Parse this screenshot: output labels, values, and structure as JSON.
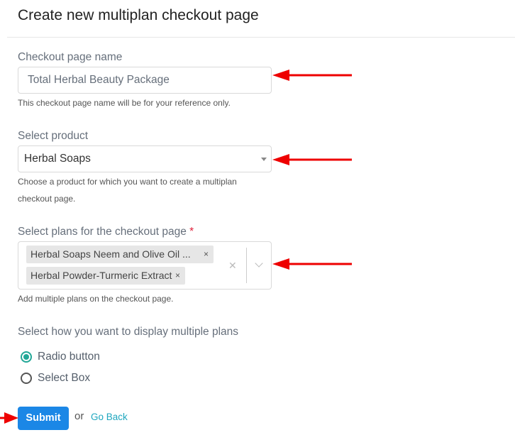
{
  "page": {
    "title": "Create new multiplan checkout page"
  },
  "form": {
    "checkout_name": {
      "label": "Checkout page name",
      "value": "Total Herbal Beauty Package",
      "help": "This checkout page name will be for your reference only."
    },
    "product": {
      "label": "Select product",
      "value": "Herbal Soaps",
      "help": "Choose a product for which you want to create a multiplan checkout page."
    },
    "plans": {
      "label": "Select plans for the checkout page",
      "required_mark": "*",
      "selected": [
        "Herbal Soaps Neem and Olive Oil ...",
        "Herbal Powder-Turmeric Extract"
      ],
      "remove_glyph": "×",
      "clear_glyph": "✕",
      "help": "Add multiple plans on the checkout page."
    },
    "display": {
      "label": "Select how you want to display multiple plans",
      "options": [
        {
          "label": "Radio button",
          "selected": true
        },
        {
          "label": "Select Box",
          "selected": false
        }
      ]
    }
  },
  "actions": {
    "submit_label": "Submit",
    "or_text": "or",
    "back_label": "Go Back"
  },
  "annotations": {
    "arrow_color": "#ee0000"
  }
}
